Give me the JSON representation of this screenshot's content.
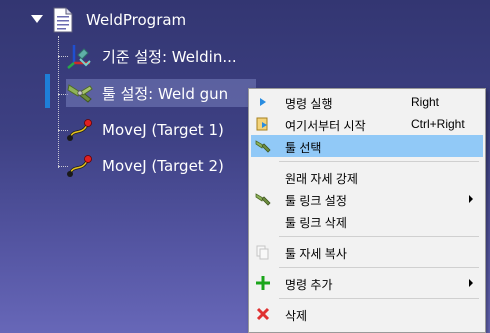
{
  "tree": {
    "program": {
      "label": "WeldProgram",
      "icon": "document-icon"
    },
    "items": [
      {
        "label": "기준 설정: Weldin...",
        "icon": "reference-frame-icon"
      },
      {
        "label": "툴 설정: Weld gun",
        "icon": "weld-gun-icon",
        "selected": true
      },
      {
        "label": "MoveJ (Target 1)",
        "icon": "movej-icon"
      },
      {
        "label": "MoveJ (Target 2)",
        "icon": "movej-icon"
      }
    ]
  },
  "context_menu": {
    "items": [
      {
        "label": "명령 실행",
        "shortcut": "Right",
        "icon": "play-icon"
      },
      {
        "label": "여기서부터 시작",
        "shortcut": "Ctrl+Right",
        "icon": "start-here-icon"
      },
      {
        "label": "툴 선택",
        "shortcut": "",
        "icon": "weld-gun-icon",
        "highlighted": true
      },
      {
        "label": "원래 자세 강제",
        "shortcut": "",
        "icon": ""
      },
      {
        "label": "툴 링크 설정",
        "shortcut": "",
        "icon": "weld-gun-icon",
        "submenu": true
      },
      {
        "label": "툴 링크 삭제",
        "shortcut": "",
        "icon": ""
      },
      {
        "label": "툴 자세 복사",
        "shortcut": "",
        "icon": "copy-icon"
      },
      {
        "label": "명령 추가",
        "shortcut": "",
        "icon": "plus-icon",
        "submenu": true
      },
      {
        "label": "삭제",
        "shortcut": "",
        "icon": "delete-icon"
      }
    ]
  },
  "colors": {
    "menu_highlight": "#91c9f7",
    "selection_bar": "#1e7fd8",
    "plus_green": "#1aa51a",
    "delete_red": "#e03131"
  }
}
